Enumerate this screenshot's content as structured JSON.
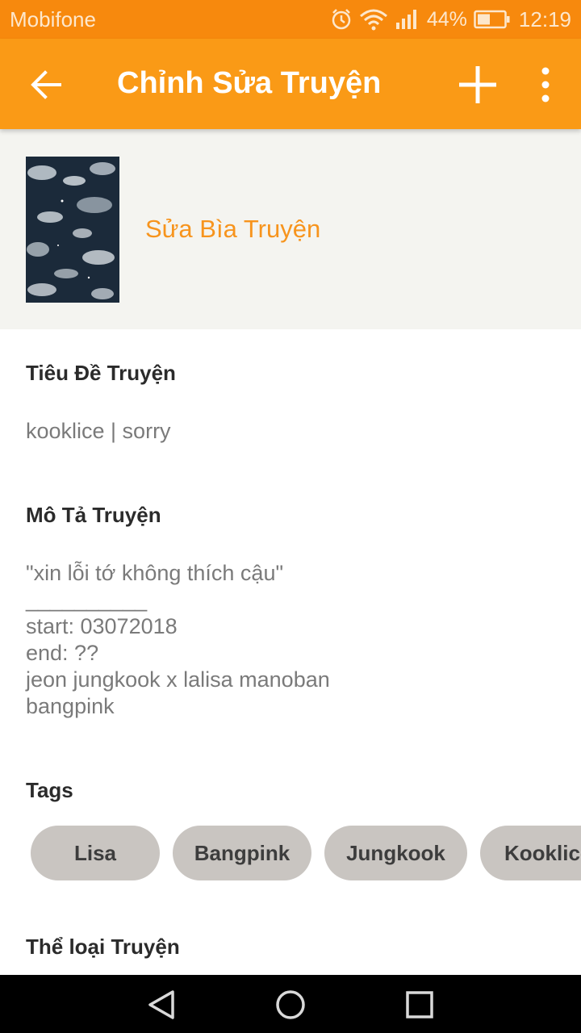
{
  "status_bar": {
    "carrier": "Mobifone",
    "battery_percent": "44%",
    "time": "12:19",
    "icons": [
      "alarm-icon",
      "wifi-icon",
      "signal-icon",
      "battery-icon"
    ]
  },
  "app_bar": {
    "title": "Chỉnh Sửa Truyện",
    "icons": [
      "back-arrow-icon",
      "plus-icon",
      "more-vert-icon"
    ]
  },
  "cover": {
    "edit_label": "Sửa Bìa Truyện"
  },
  "story_title": {
    "label": "Tiêu Đề Truyện",
    "value": "kooklice | sorry"
  },
  "story_description": {
    "label": "Mô Tả Truyện",
    "lines": [
      "\"xin lỗi tớ không thích cậu\"",
      "__________",
      "start: 03072018",
      "end: ??",
      "jeon jungkook x lalisa manoban",
      "bangpink"
    ]
  },
  "tags": {
    "label": "Tags",
    "items": [
      "Lisa",
      "Bangpink",
      "Jungkook",
      "Kooklice"
    ]
  },
  "category": {
    "label": "Thể loại Truyện"
  },
  "nav_bar": {
    "icons": [
      "nav-back-icon",
      "nav-home-icon",
      "nav-recents-icon"
    ]
  },
  "colors": {
    "status_bar": "#f7890d",
    "app_bar": "#fa9a16",
    "accent": "#f7941d",
    "tag_bg": "#c9c5c1"
  }
}
